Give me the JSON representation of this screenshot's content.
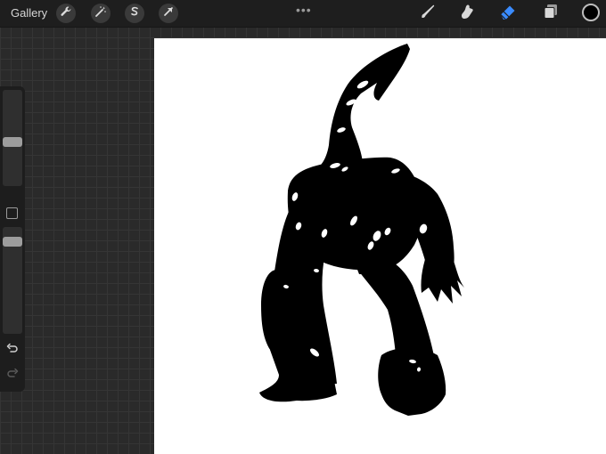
{
  "toolbar": {
    "gallery_label": "Gallery",
    "left_tools": [
      "wrench-icon",
      "magic-wand-icon",
      "selection-icon",
      "transform-arrow-icon"
    ],
    "more_label": "•••",
    "right_tools": [
      "brush-icon",
      "smudge-icon",
      "eraser-icon",
      "layers-icon"
    ],
    "active_tool": "eraser-icon",
    "current_color": "#000000",
    "accent_color": "#3a8bff"
  },
  "sidebar": {
    "brush_size_level": 0.45,
    "opacity_level": 0.1
  },
  "canvas": {
    "background": "#ffffff",
    "ink_color": "#000000"
  }
}
